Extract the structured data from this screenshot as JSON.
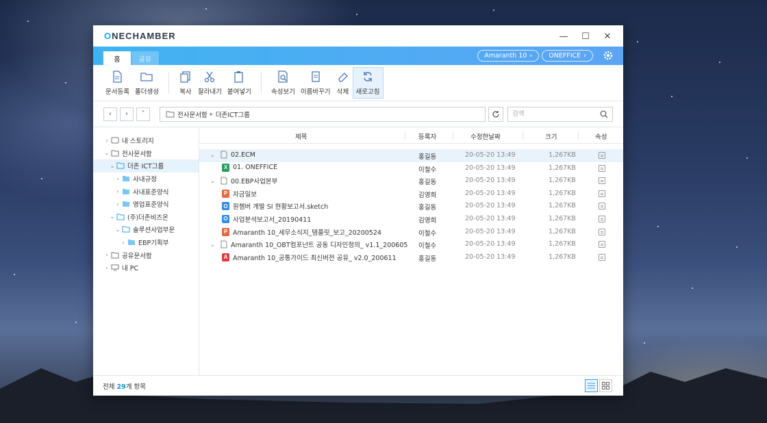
{
  "app": {
    "logo_prefix": "O",
    "logo_n": "N",
    "logo_rest": "ECHAMBER"
  },
  "window_controls": {
    "minimize": "—",
    "maximize": "☐",
    "close": "✕"
  },
  "tabs": [
    {
      "label": "홈",
      "active": true
    },
    {
      "label": "공유",
      "active": false
    }
  ],
  "header_pills": [
    {
      "label": "Amaranth 10"
    },
    {
      "label": "ONEFFICE"
    }
  ],
  "toolbar": [
    {
      "label": "문서등록",
      "icon": "document-register-icon"
    },
    {
      "label": "폴더생성",
      "icon": "folder-create-icon"
    },
    {
      "label": "복사",
      "icon": "copy-icon"
    },
    {
      "label": "잘라내기",
      "icon": "scissors-icon"
    },
    {
      "label": "붙여넣기",
      "icon": "paste-icon"
    },
    {
      "label": "속성보기",
      "icon": "properties-icon"
    },
    {
      "label": "이름바꾸기",
      "icon": "rename-icon"
    },
    {
      "label": "삭제",
      "icon": "eraser-icon"
    },
    {
      "label": "새로고침",
      "icon": "refresh-icon"
    }
  ],
  "path": {
    "root": "전사문서함",
    "sep": "▸",
    "current": "더존ICT그룹"
  },
  "search": {
    "placeholder": "검색"
  },
  "tree": [
    {
      "label": "내 스토리지"
    },
    {
      "label": "전사문서함"
    },
    {
      "label": "더존 ICT그룹"
    },
    {
      "label": "사내규정"
    },
    {
      "label": "사내표준양식"
    },
    {
      "label": "영업표준양식"
    },
    {
      "label": "(주)더존비즈온"
    },
    {
      "label": "솔루션사업부문"
    },
    {
      "label": "EBP기획부"
    },
    {
      "label": "공유문서함"
    },
    {
      "label": "내 PC"
    }
  ],
  "columns": {
    "name": "제목",
    "owner": "등록자",
    "modified": "수정한날짜",
    "size": "크기",
    "attr": "속성"
  },
  "rows": [
    {
      "name": "02.ECM",
      "owner": "홍길동",
      "date": "20-05-20 13:49",
      "size": "1,267KB"
    },
    {
      "name": "01. ONEFFICE",
      "owner": "이철수",
      "date": "20-05-20 13:49",
      "size": "1,267KB"
    },
    {
      "name": "00.EBP사업본부",
      "owner": "홍길동",
      "date": "20-05-20 13:49",
      "size": "1,267KB"
    },
    {
      "name": "자금일보",
      "owner": "김영희",
      "date": "20-05-20 13:49",
      "size": "1,267KB"
    },
    {
      "name": "원챔버 개발 SI 현황보고서.sketch",
      "owner": "홍길동",
      "date": "20-05-20 13:49",
      "size": "1,267KB"
    },
    {
      "name": "사업분석보고서_20190411",
      "owner": "김영희",
      "date": "20-05-20 13:49",
      "size": "1,267KB"
    },
    {
      "name": "Amaranth 10_세무소식지_템플릿_보고_20200524",
      "owner": "이철수",
      "date": "20-05-20 13:49",
      "size": "1,267KB"
    },
    {
      "name": "Amaranth 10_OBT컴포넌트 공동 디자인정의_ v1.1_200605",
      "owner": "이철수",
      "date": "20-05-20 13:49",
      "size": "1,267KB"
    },
    {
      "name": "Amaranth 10_공통가이드 최신버전 공유_ v2.0_200611",
      "owner": "홍길동",
      "date": "20-05-20 13:49",
      "size": "1,267KB"
    }
  ],
  "status": {
    "prefix": "전체 ",
    "count": "29",
    "suffix": "개 항목"
  },
  "colors": {
    "accent": "#1ea4f0",
    "selection": "#e6f2fc"
  }
}
